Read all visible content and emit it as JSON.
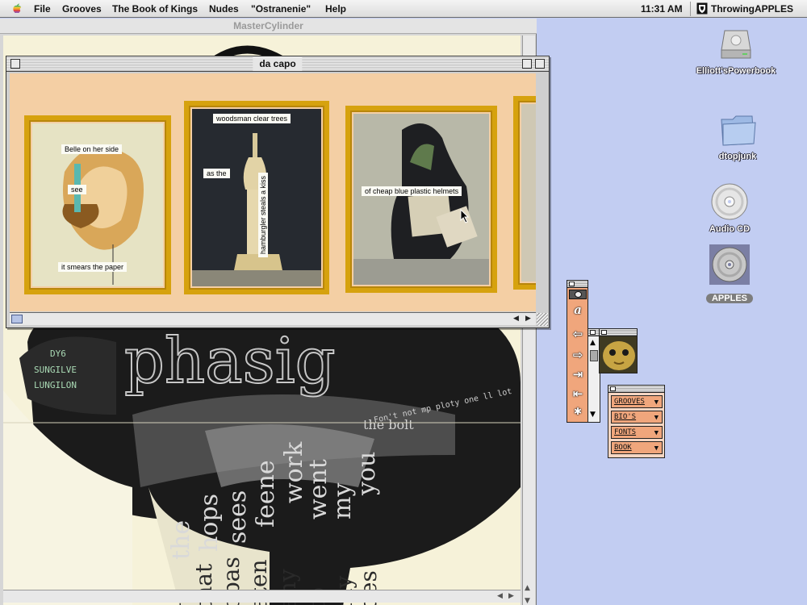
{
  "menubar": {
    "items": [
      "File",
      "Grooves",
      "The Book of Kings",
      "Nudes",
      "\"Ostranenie\"",
      "Help"
    ],
    "clock": "11:31 AM",
    "app_name": "ThrowingAPPLES"
  },
  "back_window": {
    "title": "MasterCylinder",
    "art_text": {
      "side_lines": [
        "DY6",
        "SUNGILVE",
        "LUNGILON"
      ],
      "ribbon": "Fon't not mp ploty one ll lot"
    }
  },
  "front_window": {
    "title": "da capo",
    "frames": [
      {
        "captions": [
          "Belle on her side",
          "see",
          "it smears the paper"
        ]
      },
      {
        "captions": [
          "woodsman clear trees",
          "as the",
          "hamburgler steals a kiss"
        ]
      },
      {
        "captions": [
          "of cheap blue plastic helmets"
        ]
      }
    ]
  },
  "desktop_icons": [
    {
      "label": "Elliott'sPowerbook",
      "icon": "hard-drive-icon"
    },
    {
      "label": "dtopjunk",
      "icon": "folder-icon"
    },
    {
      "label": "Audio CD",
      "icon": "cd-icon"
    },
    {
      "label": "APPLES",
      "icon": "cd-icon"
    }
  ],
  "nav_palette": {
    "buttons": [
      "eye",
      "a",
      "left",
      "right",
      "last",
      "first",
      "home"
    ]
  },
  "menu_palette": {
    "items": [
      "GROOVES",
      "BIO'S",
      "FONTS",
      "BOOK"
    ]
  }
}
